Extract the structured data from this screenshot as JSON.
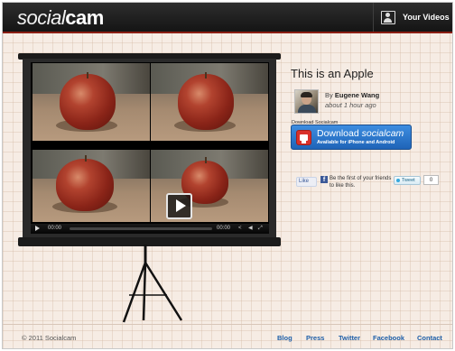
{
  "header": {
    "logo_part1": "social",
    "logo_part2": "cam",
    "your_videos_label": "Your Videos"
  },
  "video": {
    "title": "This is an Apple",
    "author_prefix": "By",
    "author": "Eugene Wang",
    "posted": "about 1 hour ago",
    "player": {
      "time_elapsed": "00:00",
      "time_total": "00:00"
    }
  },
  "download": {
    "label": "Download Socialcam",
    "button_prefix": "Download",
    "button_brand": "socialcam",
    "button_sub": "Available for iPhone and Android"
  },
  "social": {
    "like_label": "Like",
    "facebook_text": "Be the first of your friends to like this.",
    "tweet_label": "Tweet",
    "tweet_count": "0"
  },
  "footer": {
    "copyright": "© 2011 Socialcam",
    "links": [
      "Blog",
      "Press",
      "Twitter",
      "Facebook",
      "Contact"
    ]
  },
  "colors": {
    "header_bg": "#1c1c1c",
    "accent_red": "#8a1d12",
    "download_blue": "#2a74cc",
    "link_blue": "#1f5fa8",
    "page_bg": "#f6ece4"
  }
}
